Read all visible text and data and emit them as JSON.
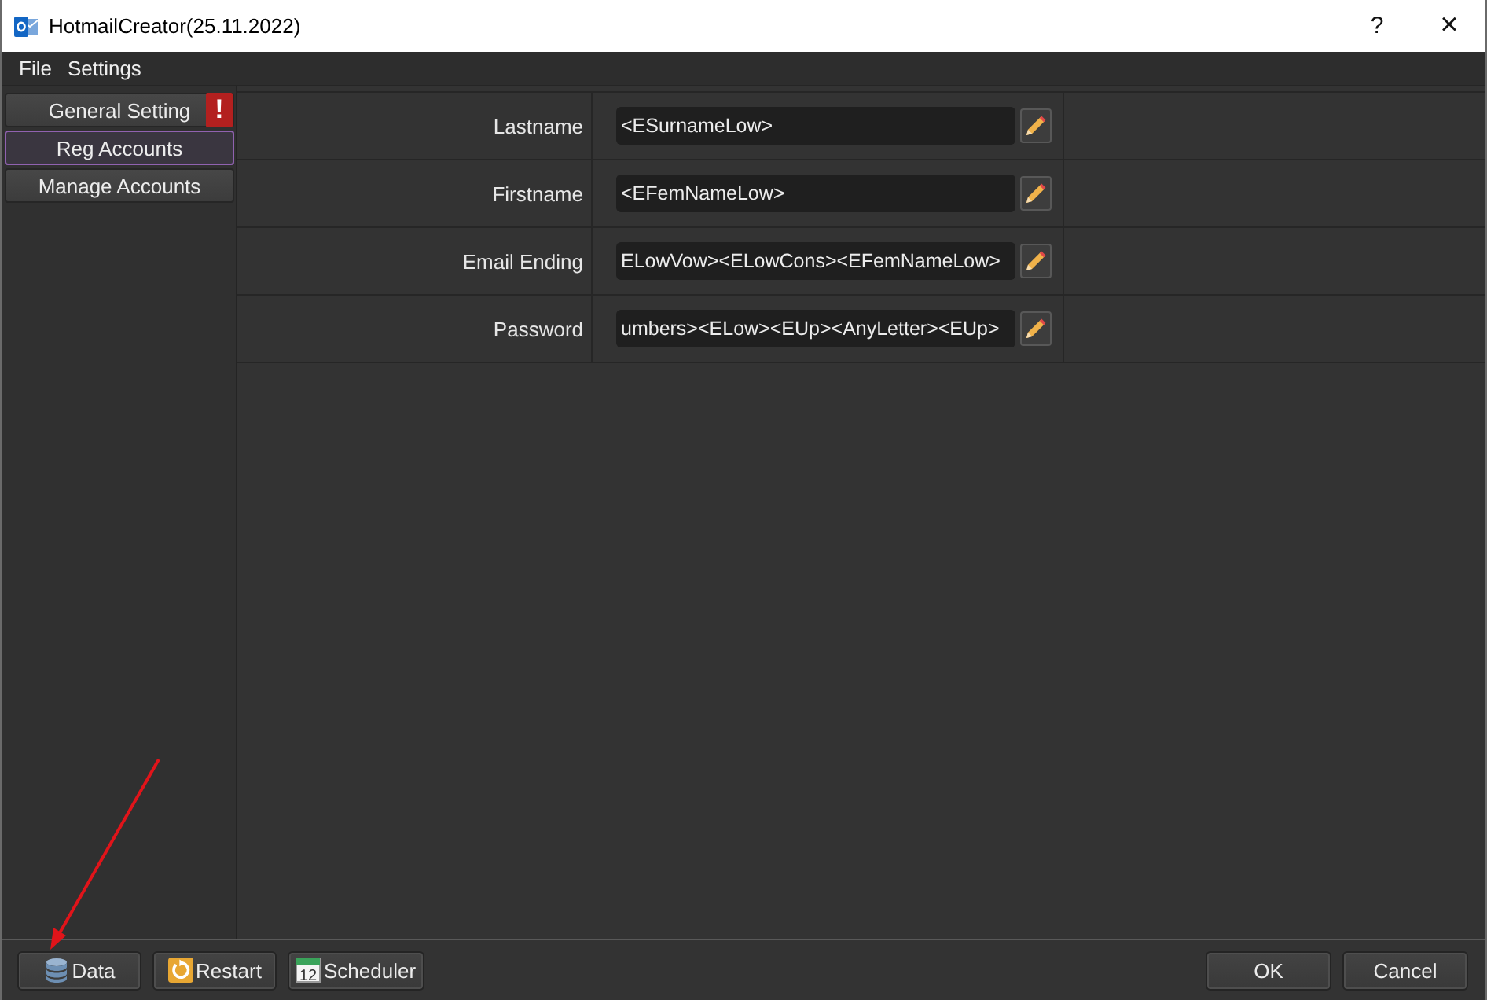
{
  "window": {
    "title": "HotmailCreator(25.11.2022)",
    "buttons": [
      {
        "kind": "help",
        "label": "?"
      },
      {
        "kind": "close",
        "label": "×"
      }
    ]
  },
  "menu": [
    "File",
    "Settings"
  ],
  "sidebar": {
    "items": [
      {
        "label": "General Setting",
        "selected": false,
        "badge": "!"
      },
      {
        "label": "Reg Accounts",
        "selected": true
      },
      {
        "label": "Manage Accounts",
        "selected": false
      }
    ]
  },
  "form": {
    "rows": [
      {
        "label": "Lastname",
        "value": "<ESurnameLow>"
      },
      {
        "label": "Firstname",
        "value": "<EFemNameLow>"
      },
      {
        "label": "Email Ending",
        "value": "ELowVow><ELowCons><EFemNameLow>"
      },
      {
        "label": "Password",
        "value": "umbers><ELow><EUp><AnyLetter><EUp>"
      }
    ]
  },
  "footer": {
    "left_buttons": [
      {
        "label": "Data",
        "kind": "database"
      },
      {
        "label": "Restart",
        "kind": "restart"
      },
      {
        "label": "Scheduler",
        "kind": "calendar",
        "icon_text": "12"
      }
    ],
    "right_buttons": [
      "OK",
      "Cancel"
    ]
  },
  "annotations": [
    {
      "kind": "arrow"
    }
  ]
}
